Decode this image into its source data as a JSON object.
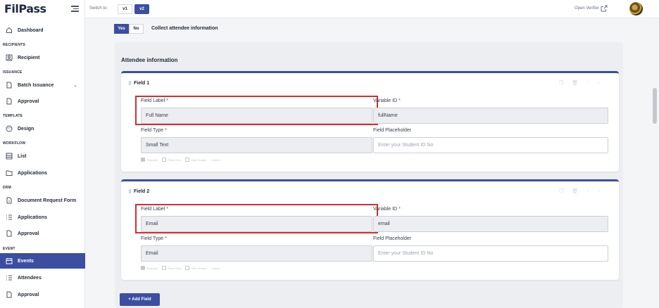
{
  "sidebar": {
    "logo": "FilPass",
    "sections": {
      "recipients": "RECIPIENTS",
      "issuance": "ISSUANCE",
      "template": "TEMPLATE",
      "workflow": "WORKFLOW",
      "drm": "DRM",
      "event": "EVENT"
    },
    "items": {
      "dashboard": "Dashboard",
      "recipient": "Recipient",
      "batch_issuance": "Batch Issuance",
      "approval_issuance": "Approval",
      "design": "Design",
      "list": "List",
      "applications_workflow": "Applications",
      "document_request_form": "Document Request Form",
      "applications_drm": "Applications",
      "approval_drm": "Approval",
      "events": "Events",
      "attendees": "Attendees",
      "approval_event": "Approval"
    },
    "active_item": "events",
    "accent_color": "#3b4ea2"
  },
  "topbar": {
    "switch_label": "Switch to:",
    "versions": [
      "v1",
      "v2"
    ],
    "active_version": "v2",
    "open_verifier": "Open Verifier"
  },
  "main": {
    "yes_label": "Yes",
    "no_label": "No",
    "collect_label": "Collect attendee information",
    "panel_title": "Attendee information",
    "fields": [
      {
        "title": "Field 1",
        "label_caption": "Field Label",
        "label_value": "Full Name",
        "variable_caption": "Variable ID",
        "variable_value": "fullName",
        "type_caption": "Field Type",
        "type_value": "Small Text",
        "placeholder_caption": "Field Placeholder",
        "placeholder_value": "Enter your Student ID No",
        "options": [
          "Required",
          "Read Only",
          "Hide Header",
          "Locked"
        ]
      },
      {
        "title": "Field 2",
        "label_caption": "Field Label",
        "label_value": "Email",
        "variable_caption": "Variable ID",
        "variable_value": "email",
        "type_caption": "Field Type",
        "type_value": "Email",
        "placeholder_caption": "Field Placeholder",
        "placeholder_value": "Enter your Student ID No",
        "options": [
          "Required",
          "Read Only",
          "Hide Header",
          "Locked"
        ]
      }
    ],
    "required_mark": "*",
    "add_field_label": "+ Add Field"
  }
}
